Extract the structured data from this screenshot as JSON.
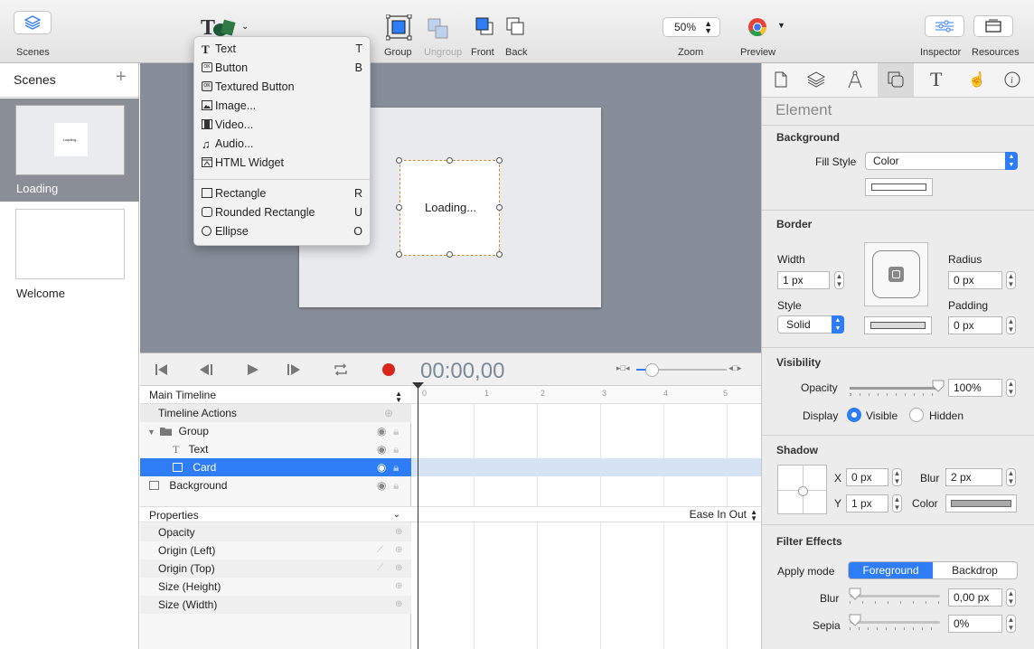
{
  "toolbar": {
    "scenes_label": "Scenes",
    "group_label": "Group",
    "ungroup_label": "Ungroup",
    "front_label": "Front",
    "back_label": "Back",
    "zoom_value": "50%",
    "zoom_label": "Zoom",
    "preview_label": "Preview",
    "inspector_label": "Inspector",
    "resources_label": "Resources",
    "accent": "#2f7df6"
  },
  "insert_menu": {
    "items": [
      {
        "label": "Text",
        "shortcut": "T",
        "icon": "text-icon"
      },
      {
        "label": "Button",
        "shortcut": "B",
        "icon": "button-icon"
      },
      {
        "label": "Textured Button",
        "shortcut": "",
        "icon": "textured-button-icon"
      },
      {
        "label": "Image...",
        "shortcut": "",
        "icon": "image-icon"
      },
      {
        "label": "Video...",
        "shortcut": "",
        "icon": "video-icon"
      },
      {
        "label": "Audio...",
        "shortcut": "",
        "icon": "audio-icon"
      },
      {
        "label": "HTML Widget",
        "shortcut": "",
        "icon": "html-widget-icon"
      },
      {
        "label": "Rectangle",
        "shortcut": "R",
        "icon": "rectangle-icon"
      },
      {
        "label": "Rounded Rectangle",
        "shortcut": "U",
        "icon": "rounded-rectangle-icon"
      },
      {
        "label": "Ellipse",
        "shortcut": "O",
        "icon": "ellipse-icon"
      }
    ],
    "icon_glyphs": {
      "text": "T",
      "button": "OK",
      "textured": "OK"
    }
  },
  "scenes": {
    "title": "Scenes",
    "add": "+",
    "items": [
      {
        "name": "Loading",
        "thumb_text": "Loading...",
        "selected": true
      },
      {
        "name": "Welcome",
        "thumb_text": "",
        "selected": false
      }
    ]
  },
  "canvas": {
    "card_text": "Loading..."
  },
  "timeline": {
    "timecode": "00:00,00",
    "main_timeline": "Main Timeline",
    "rows": [
      {
        "label": "Timeline Actions",
        "indent": 1
      },
      {
        "label": "Group",
        "indent": 0
      },
      {
        "label": "Text",
        "indent": 2
      },
      {
        "label": "Card",
        "indent": 2,
        "selected": true
      },
      {
        "label": "Background",
        "indent": 0
      }
    ],
    "properties_label": "Properties",
    "easing": "Ease In Out",
    "properties": [
      "Opacity",
      "Origin (Left)",
      "Origin (Top)",
      "Size (Height)",
      "Size (Width)"
    ],
    "ruler_ticks": [
      "0",
      "1",
      "2",
      "3",
      "4",
      "5"
    ]
  },
  "inspector": {
    "header": "Element",
    "background": {
      "title": "Background",
      "fill_style_label": "Fill Style",
      "fill_style_value": "Color"
    },
    "border": {
      "title": "Border",
      "width_label": "Width",
      "width_value": "1 px",
      "radius_label": "Radius",
      "radius_value": "0 px",
      "style_label": "Style",
      "style_value": "Solid",
      "padding_label": "Padding",
      "padding_value": "0 px"
    },
    "visibility": {
      "title": "Visibility",
      "opacity_label": "Opacity",
      "opacity_value": "100%",
      "opacity_level": 1.0,
      "display_label": "Display",
      "visible_label": "Visible",
      "hidden_label": "Hidden"
    },
    "shadow": {
      "title": "Shadow",
      "x_label": "X",
      "x_value": "0 px",
      "y_label": "Y",
      "y_value": "1 px",
      "blur_label": "Blur",
      "blur_value": "2 px",
      "color_label": "Color"
    },
    "filter": {
      "title": "Filter Effects",
      "apply_mode_label": "Apply mode",
      "foreground": "Foreground",
      "backdrop": "Backdrop",
      "blur_label": "Blur",
      "blur_value": "0,00 px",
      "sepia_label": "Sepia",
      "sepia_value": "0%"
    }
  }
}
